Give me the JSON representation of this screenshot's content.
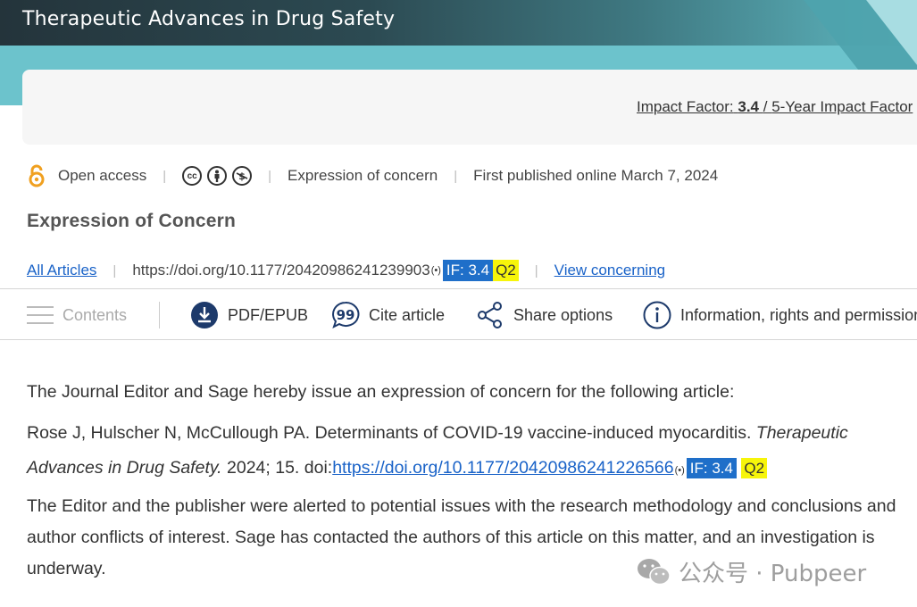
{
  "header": {
    "journal_title": "Therapeutic Advances in Drug Safety"
  },
  "impact": {
    "label": "Impact Factor:",
    "value": "3.4",
    "sep": "/",
    "five_year_label": "5-Year Impact Factor"
  },
  "meta": {
    "open_access": "Open access",
    "license_icons": [
      "cc-icon",
      "by-icon",
      "nc-icon"
    ],
    "article_kind": "Expression of concern",
    "published": "First published online March 7, 2024"
  },
  "article_type_heading": "Expression of Concern",
  "links": {
    "all_articles": "All Articles",
    "doi": "https://doi.org/10.1177/20420986241239903",
    "if_badge": "IF: 3.4",
    "q_badge": "Q2",
    "view_concerning": "View concerning"
  },
  "toolbar": {
    "contents": "Contents",
    "pdf": "PDF/EPUB",
    "cite": "Cite article",
    "share": "Share options",
    "info": "Information, rights and permissions"
  },
  "body": {
    "p1": "The Journal Editor and Sage hereby issue an expression of concern for the following article:",
    "p2_authors": "Rose J, Hulscher N, McCullough PA. Determinants of COVID-19 vaccine-induced myocarditis. ",
    "p2_journal": "Therapeutic Advances in Drug Safety.",
    "p2_year": " 2024; 15. doi:",
    "p2_doi": "https://doi.org/10.1177/20420986241226566",
    "p2_if_badge": "IF: 3.4",
    "p2_q_badge": "Q2",
    "p3": "The Editor and the publisher were alerted to potential issues with the research methodology and conclusions and author conflicts of interest. Sage has contacted the authors of this article on this matter, and an investigation is underway."
  },
  "watermark": {
    "text": "公众号 · Pubpeer"
  },
  "colors": {
    "banner_teal": "#6cc3cc",
    "link_blue": "#1a63c8",
    "if_badge_bg": "#1f6fc9",
    "q_badge_bg": "#f7f50a",
    "open_access_orange": "#f0a020"
  }
}
